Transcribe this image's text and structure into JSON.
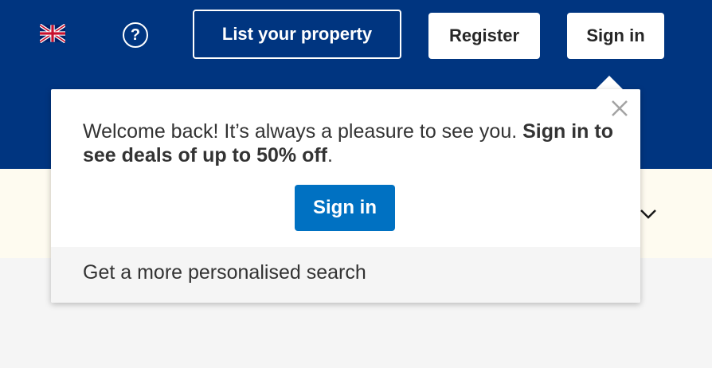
{
  "header": {
    "list_property_label": "List your property",
    "register_label": "Register",
    "signin_label": "Sign in",
    "help_glyph": "?",
    "language_icon": "uk-flag-icon",
    "bg_color": "#003580"
  },
  "popup": {
    "message_regular": "Welcome back! It’s always a pleasure to see you. ",
    "message_bold": "Sign in to see deals of up to 50% off",
    "message_end": ".",
    "signin_button_label": "Sign in",
    "footer_text": "Get a more personalised search",
    "close_icon": "close-icon",
    "button_color": "#0071c2"
  }
}
